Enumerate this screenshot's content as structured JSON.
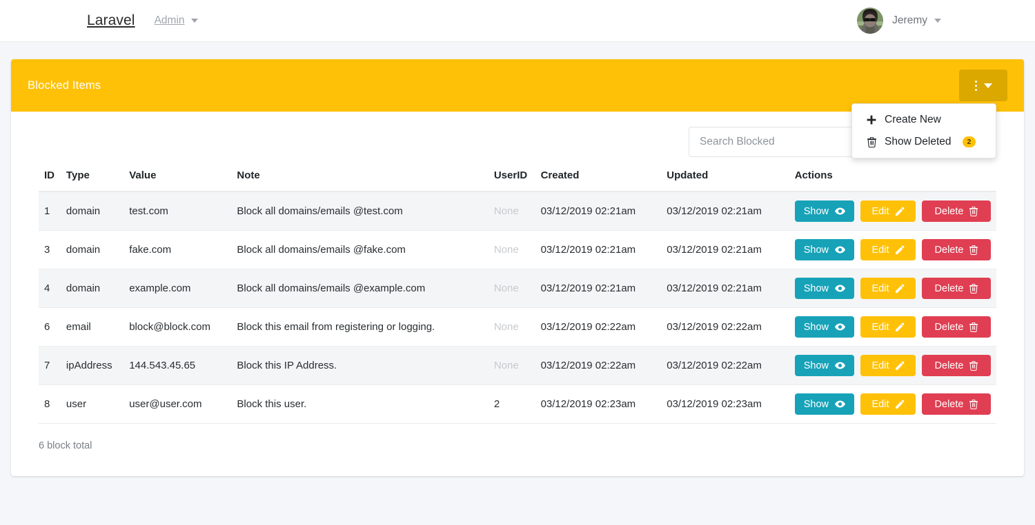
{
  "navbar": {
    "brand": "Laravel",
    "admin_link": "Admin",
    "user_name": "Jeremy",
    "avatar_alt": "user-avatar-photo"
  },
  "card": {
    "title": "Blocked Items",
    "header_color": "#ffc107",
    "kebab_button_label": "",
    "dropdown": {
      "items": [
        {
          "label": "Create New",
          "icon": "plus-icon",
          "badge": ""
        },
        {
          "label": "Show Deleted",
          "icon": "trash-icon",
          "badge": "2"
        }
      ]
    }
  },
  "search": {
    "placeholder": "Search Blocked",
    "value": ""
  },
  "table": {
    "columns": [
      "ID",
      "Type",
      "Value",
      "Note",
      "UserID",
      "Created",
      "Updated",
      "Actions"
    ],
    "rows": [
      {
        "id": "1",
        "type": "domain",
        "value": "test.com",
        "note": "Block all domains/emails @test.com",
        "user_id": "None",
        "user_id_none": true,
        "created": "03/12/2019 02:21am",
        "updated": "03/12/2019 02:21am"
      },
      {
        "id": "3",
        "type": "domain",
        "value": "fake.com",
        "note": "Block all domains/emails @fake.com",
        "user_id": "None",
        "user_id_none": true,
        "created": "03/12/2019 02:21am",
        "updated": "03/12/2019 02:21am"
      },
      {
        "id": "4",
        "type": "domain",
        "value": "example.com",
        "note": "Block all domains/emails @example.com",
        "user_id": "None",
        "user_id_none": true,
        "created": "03/12/2019 02:21am",
        "updated": "03/12/2019 02:21am"
      },
      {
        "id": "6",
        "type": "email",
        "value": "block@block.com",
        "note": "Block this email from registering or logging.",
        "user_id": "None",
        "user_id_none": true,
        "created": "03/12/2019 02:22am",
        "updated": "03/12/2019 02:22am"
      },
      {
        "id": "7",
        "type": "ipAddress",
        "value": "144.543.45.65",
        "note": "Block this IP Address.",
        "user_id": "None",
        "user_id_none": true,
        "created": "03/12/2019 02:22am",
        "updated": "03/12/2019 02:22am"
      },
      {
        "id": "8",
        "type": "user",
        "value": "user@user.com",
        "note": "Block this user.",
        "user_id": "2",
        "user_id_none": false,
        "created": "03/12/2019 02:23am",
        "updated": "03/12/2019 02:23am"
      }
    ],
    "action_labels": {
      "show": "Show",
      "edit": "Edit",
      "delete": "Delete"
    },
    "action_colors": {
      "show": "#17a2b8",
      "edit": "#ffc107",
      "delete": "#e03e52"
    }
  },
  "footer": {
    "total_text": "6 block total"
  }
}
